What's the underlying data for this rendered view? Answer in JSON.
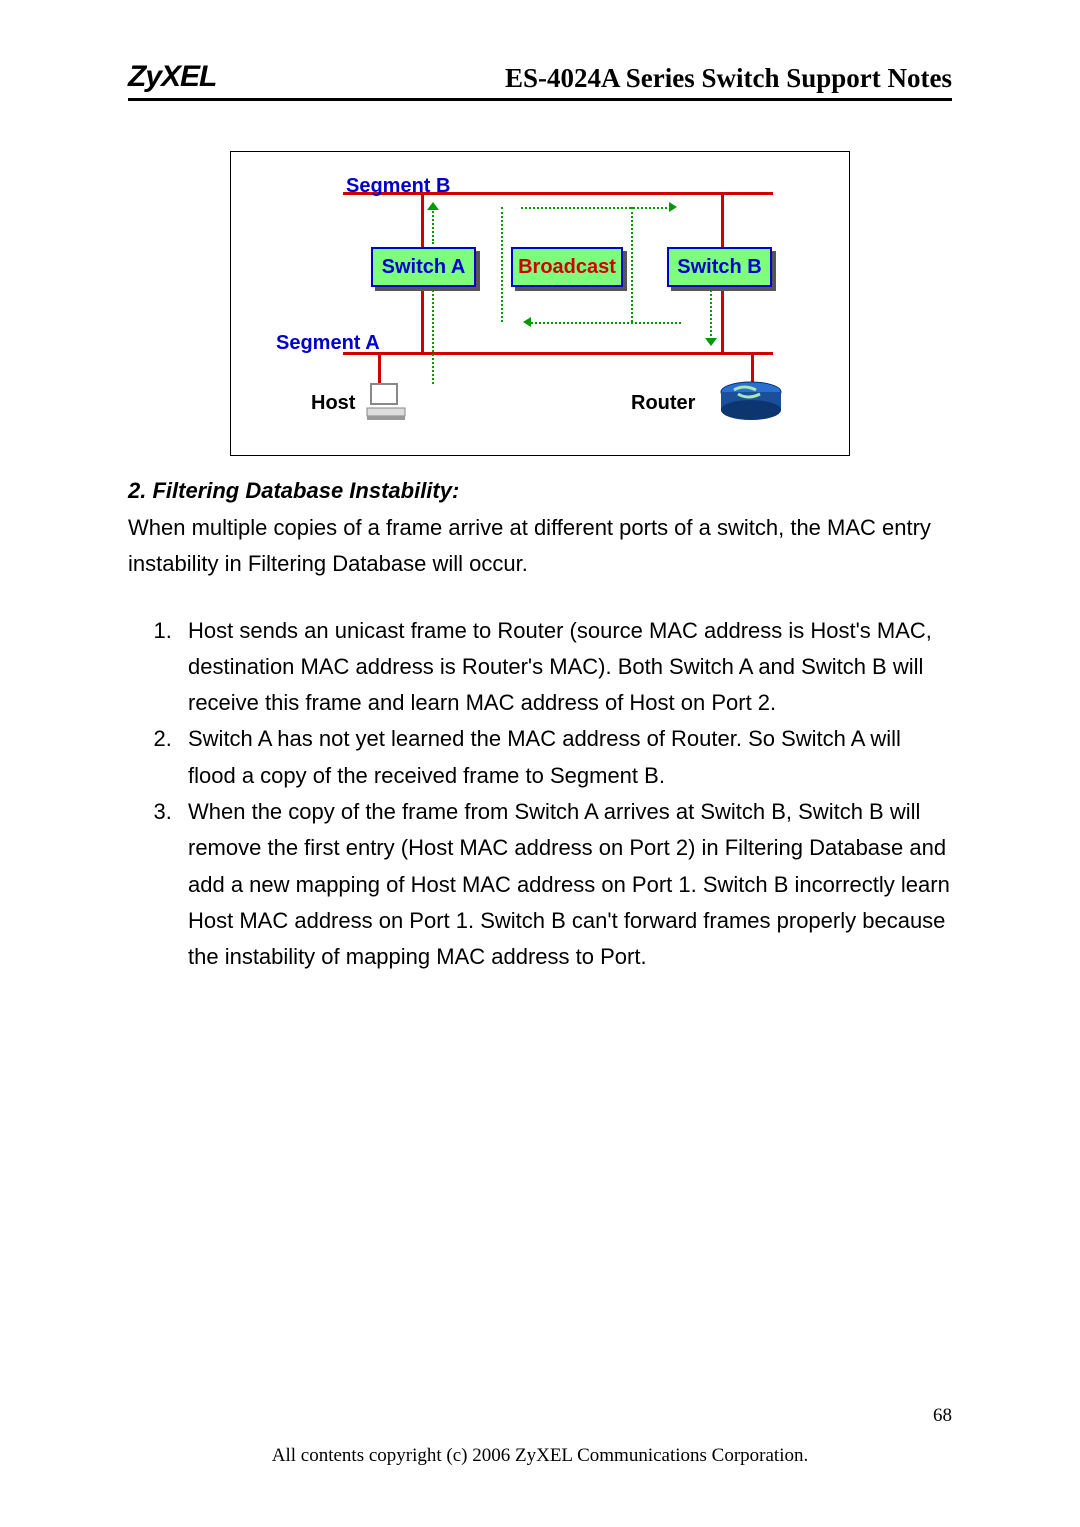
{
  "header": {
    "logo_text": "ZyXEL",
    "title": "ES-4024A Series Switch Support Notes"
  },
  "figure": {
    "segment_b": "Segment B",
    "segment_a": "Segment A",
    "switch_a": "Switch A",
    "switch_b": "Switch B",
    "broadcast": "Broadcast",
    "host": "Host",
    "router": "Router"
  },
  "section": {
    "heading": "2. Filtering Database Instability:",
    "intro": "When multiple copies of a frame arrive at different ports of a switch, the MAC entry instability in Filtering Database will occur.",
    "steps": [
      "Host sends an unicast frame to Router (source MAC address is Host's MAC, destination MAC address is Router's MAC). Both Switch A and Switch B will receive this frame and learn MAC address of Host on Port 2.",
      "Switch A has not yet learned the MAC address of Router. So Switch A will flood a copy of the received frame to Segment B.",
      "When the copy of the frame from Switch A arrives at Switch B, Switch B will remove the first entry (Host MAC address on Port 2) in Filtering Database and add a new mapping of Host MAC address on Port 1. Switch B incorrectly learn Host MAC address on Port 1. Switch B can't forward frames properly because the instability of mapping MAC address to Port."
    ]
  },
  "footer": {
    "page": "68",
    "copyright": "All contents copyright (c) 2006 ZyXEL Communications Corporation."
  }
}
